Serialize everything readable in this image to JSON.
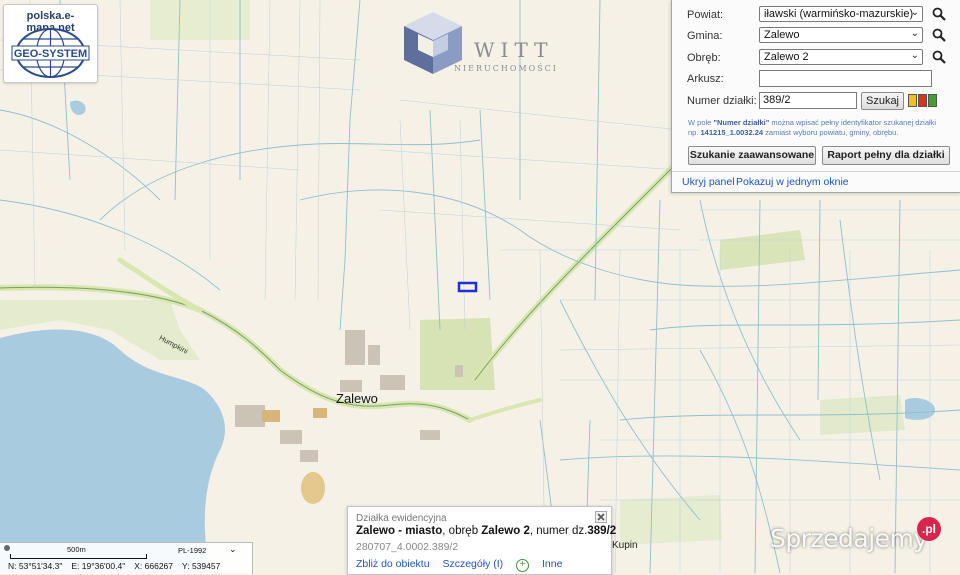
{
  "logo": {
    "site": "polska.e-mapa.net",
    "brand": "GEO-SYSTEM"
  },
  "watermark_logo": {
    "name": "WITT",
    "sub": "NIERUCHOMOŚCI"
  },
  "search_panel": {
    "powiat": {
      "label": "Powiat:",
      "value": "iławski (warmińsko-mazurskie)"
    },
    "gmina": {
      "label": "Gmina:",
      "value": "Zalewo"
    },
    "obreb": {
      "label": "Obręb:",
      "value": "Zalewo 2"
    },
    "arkusz": {
      "label": "Arkusz:",
      "value": ""
    },
    "numer": {
      "label": "Numer działki:",
      "value": "389/2"
    },
    "search_button": "Szukaj",
    "color_swatches": [
      "#f0c020",
      "#e03020",
      "#40a030"
    ],
    "hint": {
      "t1": "W pole ",
      "bold1": "\"Numer działki\"",
      "t2": " można wpisać pełny identyfikator szukanej działki np. ",
      "bold2": "141215_1.0032.24",
      "t3": " zamiast wyboru powiatu, gminy, obrębu."
    },
    "advanced_button": "Szukanie zaawansowane",
    "report_button": "Raport pełny dla działki",
    "hide_link": "Ukryj panel",
    "single_window_link": "Pokazuj w jednym oknie"
  },
  "popup": {
    "title": "Działka ewidencyjna",
    "locality": "Zalewo - miasto",
    "obreb_prefix": ", obręb ",
    "obreb": "Zalewo 2",
    "number_prefix": ", numer dz.",
    "number": "389/2",
    "identifier": "280707_4.0002.389/2",
    "link_zoom": "Zbliż do obiektu",
    "link_details": "Szczegóły (I)",
    "link_other": "Inne"
  },
  "status_bar": {
    "scale_label": "500m",
    "crs": "PL-1992",
    "n": "N: 53°51'34.3\"",
    "e": "E: 19°36'00.4\"",
    "x": "X: 666267",
    "y": "Y: 539457"
  },
  "map_labels": {
    "town": "Zalewo",
    "road": "Humpkini",
    "kupin": "Kupin"
  },
  "watermark": {
    "text": "Sprzedajemy",
    "badge": ".pl"
  }
}
